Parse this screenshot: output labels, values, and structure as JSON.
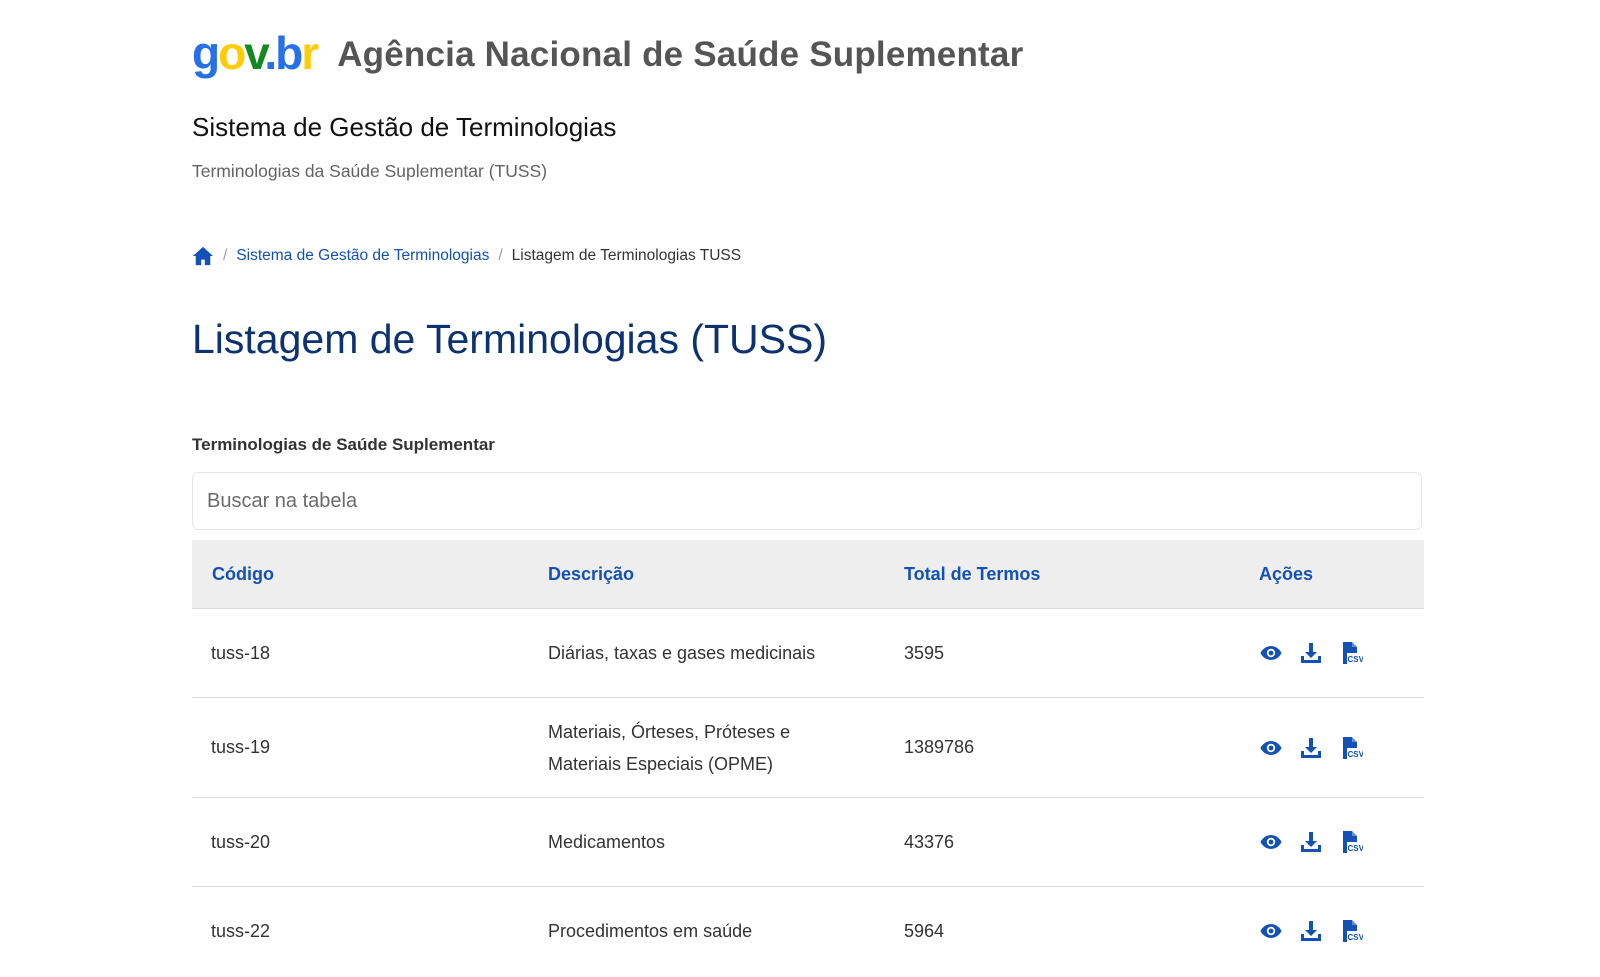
{
  "header": {
    "logo": {
      "g": "g",
      "o": "o",
      "v": "v",
      "dot": ".",
      "b": "b",
      "r": "r"
    },
    "agency_name": "Agência Nacional de Saúde Suplementar",
    "system_title": "Sistema de Gestão de Terminologias",
    "system_subtitle": "Terminologias da Saúde Suplementar (TUSS)"
  },
  "breadcrumb": {
    "home_icon": "home-icon",
    "separator": "/",
    "items": [
      {
        "label": "Sistema de Gestão de Terminologias"
      },
      {
        "label": "Listagem de Terminologias TUSS"
      }
    ]
  },
  "main": {
    "title": "Listagem de Terminologias (TUSS)",
    "table_label": "Terminologias de Saúde Suplementar",
    "search": {
      "placeholder": "Buscar na tabela"
    },
    "table": {
      "columns": [
        "Código",
        "Descrição",
        "Total de Termos",
        "Ações"
      ],
      "rows": [
        {
          "code": "tuss-18",
          "description": "Diárias, taxas e gases medicinais",
          "total": "3595"
        },
        {
          "code": "tuss-19",
          "description_line1": "Materiais, Órteses, Próteses e",
          "description_line2": "Materiais Especiais (OPME)",
          "total": "1389786"
        },
        {
          "code": "tuss-20",
          "description": "Medicamentos",
          "total": "43376"
        },
        {
          "code": "tuss-22",
          "description": "Procedimentos em saúde",
          "total": "5964"
        }
      ],
      "action_icons": [
        "eye-icon",
        "download-icon",
        "csv-file-icon"
      ]
    }
  },
  "colors": {
    "primary_blue": "#1351b4",
    "title_blue": "#0c326f",
    "header_bg": "#eeeeee",
    "agency_gray": "#555555"
  }
}
